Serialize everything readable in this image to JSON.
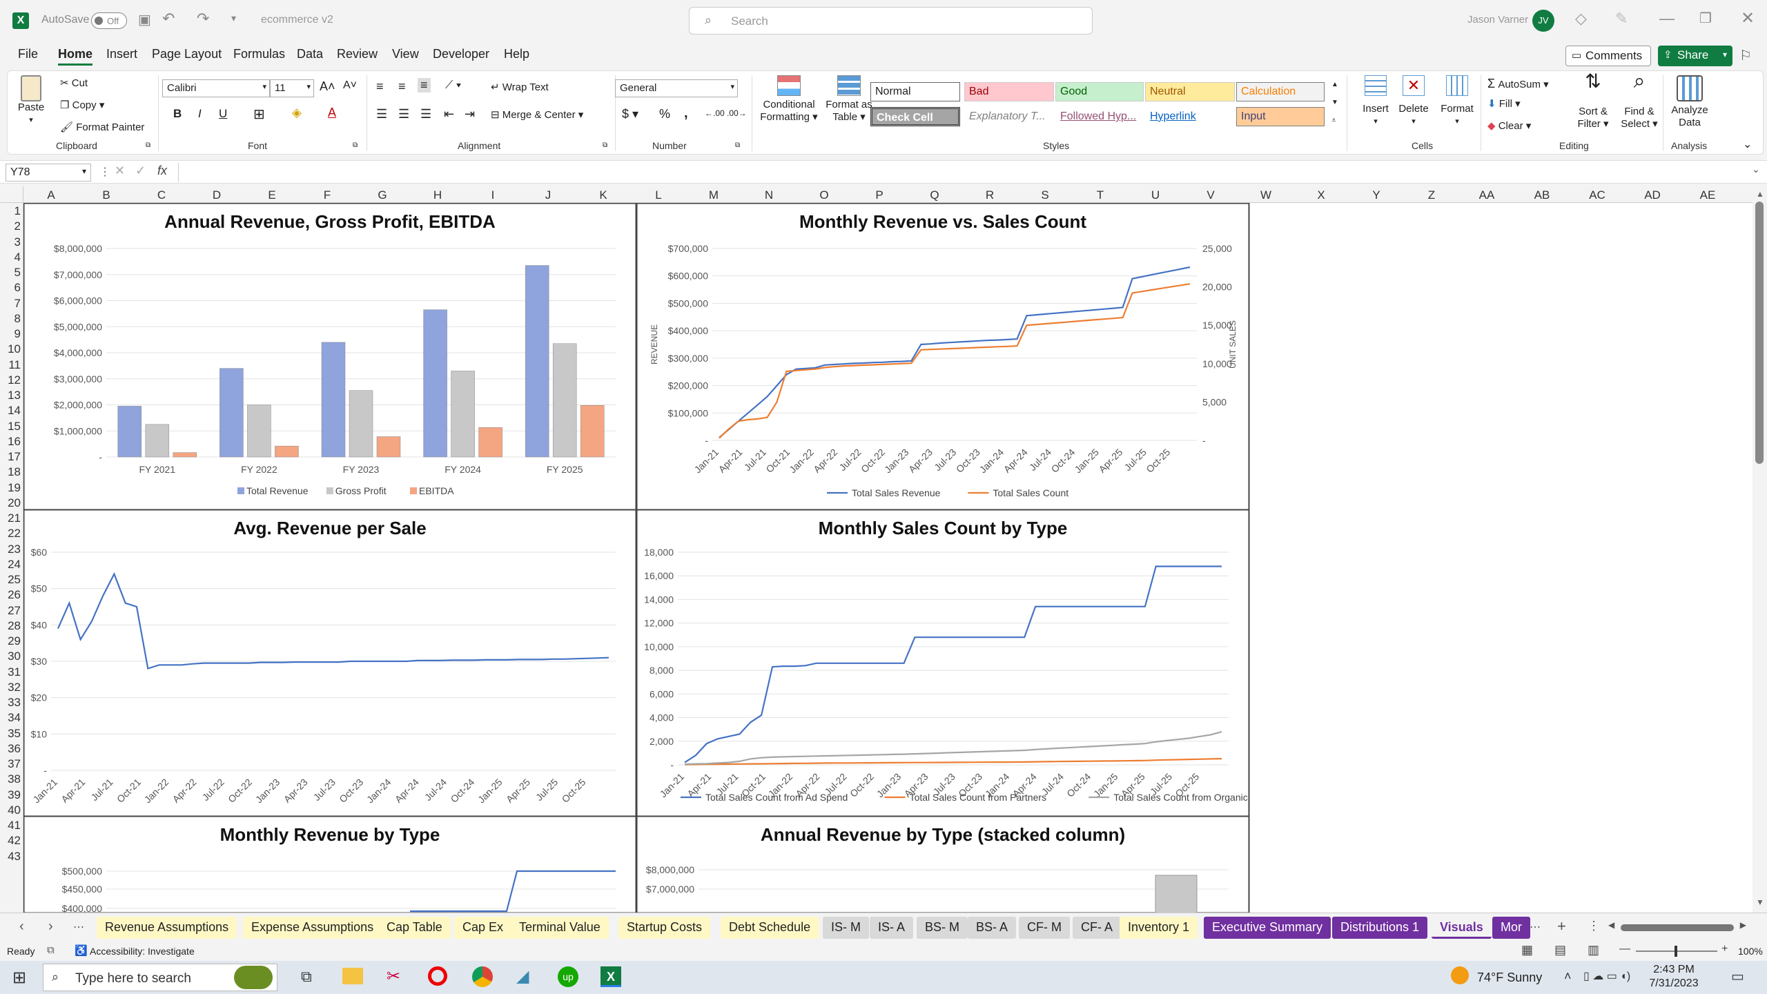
{
  "titlebar": {
    "autosave_label": "AutoSave",
    "autosave_state": "Off",
    "filename": "ecommerce v2",
    "search_placeholder": "Search",
    "user_name": "Jason Varner",
    "user_initials": "JV"
  },
  "menu": [
    "File",
    "Home",
    "Insert",
    "Page Layout",
    "Formulas",
    "Data",
    "Review",
    "View",
    "Developer",
    "Help"
  ],
  "menu_active": "Home",
  "comments_label": "Comments",
  "share_label": "Share",
  "ribbon": {
    "clipboard": {
      "paste": "Paste",
      "cut": "Cut",
      "copy": "Copy",
      "format_painter": "Format Painter",
      "group": "Clipboard"
    },
    "font": {
      "name": "Calibri",
      "size": "11",
      "group": "Font"
    },
    "alignment": {
      "wrap": "Wrap Text",
      "merge": "Merge & Center",
      "group": "Alignment"
    },
    "number": {
      "format": "General",
      "group": "Number"
    },
    "styles": {
      "conditional": "Conditional Formatting",
      "format_table": "Format as Table",
      "group": "Styles",
      "cells": [
        "Normal",
        "Bad",
        "Good",
        "Neutral",
        "Calculation",
        "Check Cell",
        "Explanatory T...",
        "Followed Hyp...",
        "Hyperlink",
        "Input"
      ]
    },
    "cells": {
      "insert": "Insert",
      "delete": "Delete",
      "format": "Format",
      "group": "Cells"
    },
    "editing": {
      "autosum": "AutoSum",
      "fill": "Fill",
      "clear": "Clear",
      "sort": "Sort & Filter",
      "find": "Find & Select",
      "group": "Editing"
    },
    "analysis": {
      "analyze": "Analyze Data",
      "group": "Analysis"
    }
  },
  "formula": {
    "name_box": "Y78",
    "fx": "fx",
    "value": ""
  },
  "columns": [
    "A",
    "B",
    "C",
    "D",
    "E",
    "F",
    "G",
    "H",
    "I",
    "J",
    "K",
    "L",
    "M",
    "N",
    "O",
    "P",
    "Q",
    "R",
    "S",
    "T",
    "U",
    "V",
    "W",
    "X",
    "Y",
    "Z",
    "AA",
    "AB",
    "AC",
    "AD",
    "AE"
  ],
  "rows": [
    "1",
    "2",
    "3",
    "4",
    "5",
    "6",
    "7",
    "8",
    "9",
    "10",
    "11",
    "12",
    "13",
    "14",
    "15",
    "16",
    "17",
    "18",
    "19",
    "20",
    "21",
    "22",
    "23",
    "24",
    "25",
    "26",
    "27",
    "28",
    "29",
    "30",
    "31",
    "32",
    "33",
    "34",
    "35",
    "36",
    "37",
    "38",
    "39",
    "40",
    "41",
    "42",
    "43"
  ],
  "chart_data": [
    {
      "type": "bar",
      "title": "Annual Revenue, Gross Profit, EBITDA",
      "categories": [
        "FY 2021",
        "FY 2022",
        "FY 2023",
        "FY 2024",
        "FY 2025"
      ],
      "series": [
        {
          "name": "Total Revenue",
          "values": [
            1950000,
            3400000,
            4400000,
            5650000,
            7350000
          ],
          "color": "#8fa3dc"
        },
        {
          "name": "Gross Profit",
          "values": [
            1250000,
            2000000,
            2550000,
            3300000,
            4350000
          ],
          "color": "#c8c8c8"
        },
        {
          "name": "EBITDA",
          "values": [
            170000,
            420000,
            780000,
            1130000,
            1980000
          ],
          "color": "#f4a582"
        }
      ],
      "ylim": [
        0,
        8000000
      ],
      "yticks": [
        "-",
        "$1,000,000",
        "$2,000,000",
        "$3,000,000",
        "$4,000,000",
        "$5,000,000",
        "$6,000,000",
        "$7,000,000",
        "$8,000,000"
      ]
    },
    {
      "type": "line",
      "title": "Monthly Revenue vs. Sales Count",
      "ylabel": "REVENUE",
      "y2label": "UNIT SALES",
      "xticks": [
        "Jan-21",
        "Apr-21",
        "Jul-21",
        "Oct-21",
        "Jan-22",
        "Apr-22",
        "Jul-22",
        "Oct-22",
        "Jan-23",
        "Apr-23",
        "Jul-23",
        "Oct-23",
        "Jan-24",
        "Apr-24",
        "Jul-24",
        "Oct-24",
        "Jan-25",
        "Apr-25",
        "Jul-25",
        "Oct-25"
      ],
      "yticks": [
        "-",
        "$100,000",
        "$200,000",
        "$300,000",
        "$400,000",
        "$500,000",
        "$600,000",
        "$700,000"
      ],
      "y2ticks": [
        "-",
        "5,000",
        "10,000",
        "15,000",
        "20,000",
        "25,000"
      ],
      "ylim": [
        0,
        700000
      ],
      "y2lim": [
        0,
        25000
      ],
      "series": [
        {
          "name": "Total Sales Revenue",
          "color": "#4472c4",
          "axis": "left",
          "values": [
            10000,
            40000,
            70000,
            100000,
            130000,
            160000,
            200000,
            240000,
            260000,
            262000,
            265000,
            275000,
            277000,
            279000,
            281000,
            282000,
            284000,
            285000,
            287000,
            288000,
            290000,
            350000,
            352000,
            355000,
            357000,
            359000,
            361000,
            363000,
            365000,
            366000,
            368000,
            370000,
            455000,
            458000,
            461000,
            464000,
            467000,
            470000,
            473000,
            476000,
            479000,
            482000,
            485000,
            590000,
            597000,
            604000,
            611000,
            618000,
            625000,
            632000
          ]
        },
        {
          "name": "Total Sales Count",
          "color": "#ed7d31",
          "axis": "right",
          "values": [
            300,
            1500,
            2500,
            2700,
            2800,
            3000,
            5000,
            9000,
            9100,
            9200,
            9300,
            9500,
            9600,
            9700,
            9750,
            9800,
            9850,
            9900,
            9950,
            10000,
            10050,
            11800,
            11850,
            11900,
            11950,
            12000,
            12050,
            12100,
            12150,
            12200,
            12250,
            12300,
            15000,
            15100,
            15200,
            15300,
            15400,
            15500,
            15600,
            15700,
            15800,
            15900,
            16000,
            19200,
            19400,
            19600,
            19800,
            20000,
            20200,
            20400
          ]
        }
      ]
    },
    {
      "type": "line",
      "title": "Avg. Revenue per Sale",
      "xticks": [
        "Jan-21",
        "Apr-21",
        "Jul-21",
        "Oct-21",
        "Jan-22",
        "Apr-22",
        "Jul-22",
        "Oct-22",
        "Jan-23",
        "Apr-23",
        "Jul-23",
        "Oct-23",
        "Jan-24",
        "Apr-24",
        "Jul-24",
        "Oct-24",
        "Jan-25",
        "Apr-25",
        "Jul-25",
        "Oct-25"
      ],
      "yticks": [
        "-",
        "$10",
        "$20",
        "$30",
        "$40",
        "$50",
        "$60"
      ],
      "ylim": [
        0,
        60
      ],
      "series": [
        {
          "name": "",
          "color": "#4472c4",
          "values": [
            39,
            46,
            36,
            41,
            48,
            54,
            46,
            45,
            28,
            29,
            29,
            29,
            29.3,
            29.5,
            29.5,
            29.5,
            29.5,
            29.5,
            29.7,
            29.7,
            29.7,
            29.8,
            29.8,
            29.8,
            29.8,
            29.8,
            30,
            30,
            30,
            30,
            30,
            30,
            30.2,
            30.2,
            30.2,
            30.3,
            30.3,
            30.3,
            30.4,
            30.4,
            30.4,
            30.5,
            30.5,
            30.5,
            30.6,
            30.6,
            30.7,
            30.8,
            30.9,
            31
          ]
        }
      ]
    },
    {
      "type": "line",
      "title": "Monthly Sales Count by Type",
      "xticks": [
        "Jan-21",
        "Apr-21",
        "Jul-21",
        "Oct-21",
        "Jan-22",
        "Apr-22",
        "Jul-22",
        "Oct-22",
        "Jan-23",
        "Apr-23",
        "Jul-23",
        "Oct-23",
        "Jan-24",
        "Apr-24",
        "Jul-24",
        "Oct-24",
        "Jan-25",
        "Apr-25",
        "Jul-25",
        "Oct-25"
      ],
      "yticks": [
        "-",
        "2,000",
        "4,000",
        "6,000",
        "8,000",
        "10,000",
        "12,000",
        "14,000",
        "16,000",
        "18,000"
      ],
      "ylim": [
        0,
        18000
      ],
      "series": [
        {
          "name": "Total Sales Count from Ad Spend",
          "color": "#4472c4",
          "values": [
            200,
            800,
            1800,
            2200,
            2400,
            2600,
            3600,
            4200,
            8300,
            8350,
            8350,
            8400,
            8600,
            8600,
            8600,
            8600,
            8600,
            8600,
            8600,
            8600,
            8600,
            10800,
            10800,
            10800,
            10800,
            10800,
            10800,
            10800,
            10800,
            10800,
            10800,
            10800,
            13400,
            13400,
            13400,
            13400,
            13400,
            13400,
            13400,
            13400,
            13400,
            13400,
            13400,
            16800,
            16800,
            16800,
            16800,
            16800,
            16800,
            16800
          ]
        },
        {
          "name": "Total Sales Count from Partners",
          "color": "#ed7d31",
          "values": [
            20,
            30,
            40,
            50,
            60,
            70,
            80,
            90,
            100,
            110,
            120,
            130,
            140,
            150,
            155,
            160,
            165,
            170,
            175,
            180,
            185,
            190,
            195,
            200,
            205,
            210,
            215,
            220,
            225,
            230,
            235,
            240,
            260,
            270,
            280,
            290,
            300,
            310,
            320,
            330,
            340,
            350,
            360,
            400,
            420,
            440,
            460,
            480,
            500,
            520
          ]
        },
        {
          "name": "Total Sales Count from Organic",
          "color": "#a5a5a5",
          "values": [
            50,
            80,
            100,
            150,
            200,
            300,
            500,
            600,
            650,
            680,
            700,
            720,
            740,
            760,
            780,
            800,
            820,
            840,
            860,
            880,
            900,
            930,
            960,
            990,
            1020,
            1050,
            1080,
            1110,
            1140,
            1170,
            1200,
            1230,
            1300,
            1350,
            1400,
            1450,
            1500,
            1550,
            1600,
            1650,
            1700,
            1750,
            1800,
            1950,
            2050,
            2150,
            2250,
            2400,
            2550,
            2800
          ]
        }
      ]
    },
    {
      "type": "line",
      "title": "Monthly Revenue by Type",
      "yticks": [
        "$400,000",
        "$450,000",
        "$500,000"
      ],
      "series": [
        {
          "name": "",
          "color": "#4472c4",
          "values": []
        }
      ]
    },
    {
      "type": "bar",
      "title": "Annual Revenue by Type (stacked column)",
      "yticks": [
        "$7,000,000",
        "$8,000,000"
      ]
    }
  ],
  "sheet_tabs": [
    {
      "label": "Revenue Assumptions",
      "bg": "#fff8c5",
      "fg": "#222"
    },
    {
      "label": "Expense Assumptions",
      "bg": "#fff8c5",
      "fg": "#222"
    },
    {
      "label": "Cap Table",
      "bg": "#fff8c5",
      "fg": "#222"
    },
    {
      "label": "Cap Ex",
      "bg": "#fff8c5",
      "fg": "#222"
    },
    {
      "label": "Terminal Value",
      "bg": "#fff8c5",
      "fg": "#222"
    },
    {
      "label": "Startup Costs",
      "bg": "#fff8c5",
      "fg": "#222"
    },
    {
      "label": "Debt Schedule",
      "bg": "#fff8c5",
      "fg": "#222"
    },
    {
      "label": "IS- M",
      "bg": "#d9d9d9",
      "fg": "#222"
    },
    {
      "label": "IS- A",
      "bg": "#d9d9d9",
      "fg": "#222"
    },
    {
      "label": "BS- M",
      "bg": "#d9d9d9",
      "fg": "#222"
    },
    {
      "label": "BS- A",
      "bg": "#d9d9d9",
      "fg": "#222"
    },
    {
      "label": "CF- M",
      "bg": "#d9d9d9",
      "fg": "#222"
    },
    {
      "label": "CF- A",
      "bg": "#d9d9d9",
      "fg": "#222"
    },
    {
      "label": "Inventory 1",
      "bg": "#fff8c5",
      "fg": "#222"
    },
    {
      "label": "Executive Summary",
      "bg": "#7030a0",
      "fg": "#fff"
    },
    {
      "label": "Distributions 1",
      "bg": "#7030a0",
      "fg": "#fff"
    },
    {
      "label": "Visuals",
      "bg": "#f3f3f3",
      "fg": "#7030a0"
    },
    {
      "label": "Mor",
      "bg": "#7030a0",
      "fg": "#fff"
    }
  ],
  "status": {
    "ready": "Ready",
    "accessibility": "Accessibility: Investigate",
    "zoom": "100%"
  },
  "taskbar": {
    "search_placeholder": "Type here to search",
    "weather": "74°F  Sunny",
    "time": "2:43 PM",
    "date": "7/31/2023"
  }
}
